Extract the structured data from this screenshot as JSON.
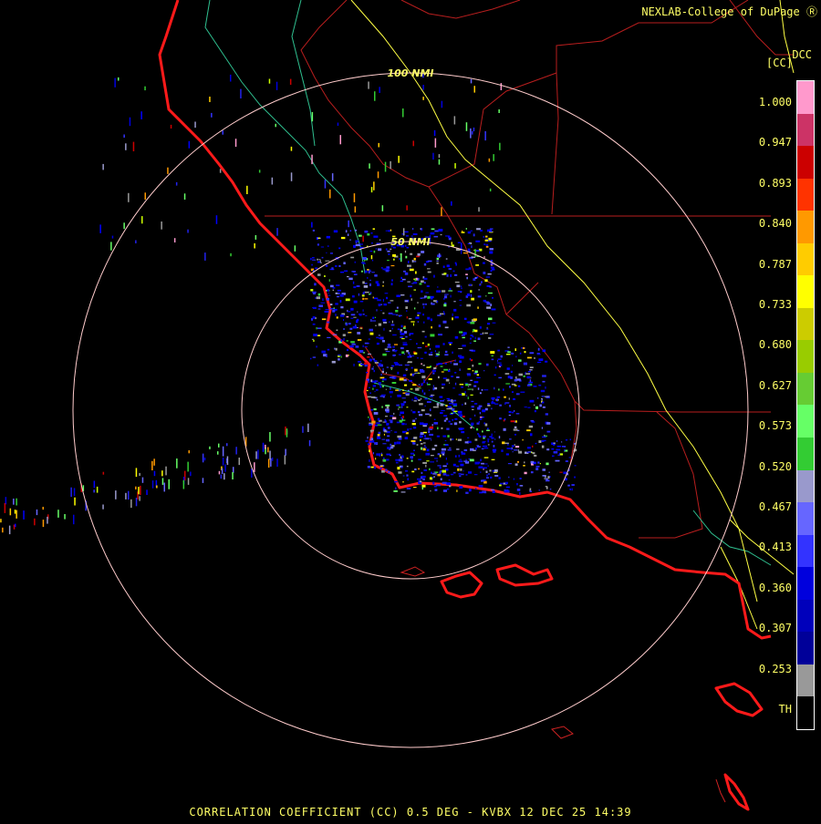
{
  "credit": "NEXLAB-College of DuPage",
  "credit_glyph": "Ⓡ",
  "product_code": "DCC",
  "units_label": "[CC]",
  "footer": "CORRELATION COEFFICIENT (CC) 0.5 DEG - KVBX 12 DEC 25 14:39",
  "rings": [
    {
      "label": "50 NMI",
      "radius_nmi": 50
    },
    {
      "label": "100 NMI",
      "radius_nmi": 100
    }
  ],
  "colorbar": {
    "labels": [
      "1.000",
      "0.947",
      "0.893",
      "0.840",
      "0.787",
      "0.733",
      "0.680",
      "0.627",
      "0.573",
      "0.520",
      "0.467",
      "0.413",
      "0.360",
      "0.307",
      "0.253",
      "TH"
    ],
    "stops": [
      "#ff99cc",
      "#cc3366",
      "#cc0000",
      "#ff3300",
      "#ff9900",
      "#ffcc00",
      "#ffff00",
      "#cccc00",
      "#99cc00",
      "#66cc33",
      "#66ff66",
      "#33cc33",
      "#9999cc",
      "#6666ff",
      "#3333ff",
      "#0000dd",
      "#0000bb",
      "#000099",
      "#999999",
      "#000000"
    ]
  },
  "colors": {
    "ring": "#ffcccc",
    "coast": "#ff0000",
    "county": "#cc2222",
    "highway": "#ffff44",
    "river": "#33cc99",
    "label": "#ffff66"
  }
}
